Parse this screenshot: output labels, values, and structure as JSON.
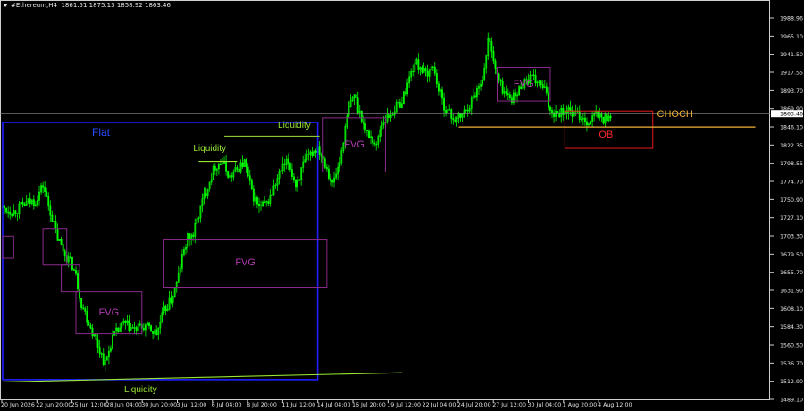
{
  "header": {
    "symbol": "#Ethereum,H4",
    "ohlc": "1861.51 1875.13 1858.92 1863.46"
  },
  "colors": {
    "background": "#000000",
    "candle": "#00ff00",
    "axis_text": "#e6e6e6",
    "flat_box": "#1f1fff",
    "fvg_box": "#8b2a8b",
    "liquidity": "#99e633",
    "choch": "#f2b233",
    "ob_box": "#e61a1a",
    "current_price_line": "#8c8c8c"
  },
  "chart_data": {
    "type": "candlestick",
    "title": "#Ethereum,H4",
    "y_ticks": [
      "1988.96",
      "1965.10",
      "1941.50",
      "1917.55",
      "1893.70",
      "1869.90",
      "1846.10",
      "1822.35",
      "1798.55",
      "1774.70",
      "1750.90",
      "1727.10",
      "1703.30",
      "1679.50",
      "1655.70",
      "1631.90",
      "1608.10",
      "1584.30",
      "1560.50",
      "1536.70",
      "1512.90",
      "1489.10"
    ],
    "ylim": [
      1489.1,
      1988.96
    ],
    "current_price": "1863.46",
    "x_ticks": [
      "20 Jun 2026",
      "22 Jun 20:00",
      "25 Jun 12:00",
      "28 Jun 04:00",
      "30 Jun 20:00",
      "3 Jul 12:00",
      "6 Jul 04:00",
      "8 Jul 20:00",
      "11 Jul 12:00",
      "14 Jul 04:00",
      "16 Jul 20:00",
      "19 Jul 12:00",
      "22 Jul 04:00",
      "24 Jul 20:00",
      "27 Jul 12:00",
      "30 Jul 04:00",
      "1 Aug 20:00",
      "4 Aug 12:00"
    ],
    "anchors": [
      [
        0,
        1740
      ],
      [
        6,
        1735
      ],
      [
        12,
        1745
      ],
      [
        18,
        1750
      ],
      [
        22,
        1770
      ],
      [
        26,
        1735
      ],
      [
        30,
        1700
      ],
      [
        34,
        1680
      ],
      [
        38,
        1665
      ],
      [
        40,
        1650
      ],
      [
        43,
        1615
      ],
      [
        47,
        1590
      ],
      [
        52,
        1560
      ],
      [
        56,
        1535
      ],
      [
        60,
        1570
      ],
      [
        66,
        1588
      ],
      [
        72,
        1580
      ],
      [
        78,
        1585
      ],
      [
        84,
        1575
      ],
      [
        88,
        1605
      ],
      [
        92,
        1620
      ],
      [
        95,
        1640
      ],
      [
        98,
        1675
      ],
      [
        101,
        1700
      ],
      [
        104,
        1705
      ],
      [
        108,
        1740
      ],
      [
        112,
        1770
      ],
      [
        116,
        1795
      ],
      [
        120,
        1800
      ],
      [
        124,
        1780
      ],
      [
        128,
        1790
      ],
      [
        132,
        1800
      ],
      [
        136,
        1760
      ],
      [
        140,
        1740
      ],
      [
        144,
        1745
      ],
      [
        148,
        1765
      ],
      [
        152,
        1790
      ],
      [
        156,
        1800
      ],
      [
        160,
        1770
      ],
      [
        164,
        1795
      ],
      [
        168,
        1810
      ],
      [
        172,
        1820
      ],
      [
        176,
        1800
      ],
      [
        180,
        1770
      ],
      [
        184,
        1800
      ],
      [
        186,
        1830
      ],
      [
        189,
        1870
      ],
      [
        192,
        1890
      ],
      [
        194,
        1870
      ],
      [
        196,
        1860
      ],
      [
        198,
        1840
      ],
      [
        200,
        1835
      ],
      [
        202,
        1830
      ],
      [
        204,
        1820
      ],
      [
        206,
        1845
      ],
      [
        208,
        1855
      ],
      [
        211,
        1860
      ],
      [
        214,
        1870
      ],
      [
        218,
        1880
      ],
      [
        222,
        1910
      ],
      [
        225,
        1930
      ],
      [
        228,
        1925
      ],
      [
        232,
        1910
      ],
      [
        234,
        1930
      ],
      [
        236,
        1915
      ],
      [
        238,
        1895
      ],
      [
        240,
        1880
      ],
      [
        242,
        1870
      ],
      [
        245,
        1860
      ],
      [
        248,
        1855
      ],
      [
        252,
        1865
      ],
      [
        256,
        1880
      ],
      [
        260,
        1900
      ],
      [
        263,
        1920
      ],
      [
        265,
        1960
      ],
      [
        267,
        1950
      ],
      [
        269,
        1920
      ],
      [
        272,
        1900
      ],
      [
        276,
        1885
      ],
      [
        280,
        1885
      ],
      [
        284,
        1905
      ],
      [
        288,
        1910
      ],
      [
        292,
        1905
      ],
      [
        296,
        1895
      ],
      [
        298,
        1875
      ],
      [
        300,
        1866
      ],
      [
        304,
        1866
      ],
      [
        308,
        1868
      ],
      [
        312,
        1863
      ],
      [
        316,
        1860
      ],
      [
        320,
        1852
      ],
      [
        324,
        1863
      ],
      [
        328,
        1856
      ],
      [
        332,
        1863
      ]
    ],
    "zones": [
      {
        "kind": "flat",
        "label": "Flat",
        "t1": 0,
        "t2": 172,
        "top": 1852,
        "bottom": 1515
      },
      {
        "kind": "fvg",
        "label": "",
        "t1": 0,
        "t2": 6,
        "top": 1703,
        "bottom": 1674
      },
      {
        "kind": "fvg",
        "label": "",
        "t1": 22,
        "t2": 35,
        "top": 1713,
        "bottom": 1665
      },
      {
        "kind": "fvg",
        "label": "",
        "t1": 32,
        "t2": 42,
        "top": 1665,
        "bottom": 1630
      },
      {
        "kind": "fvg",
        "label": "FVG",
        "t1": 40,
        "t2": 76,
        "top": 1630,
        "bottom": 1575
      },
      {
        "kind": "fvg",
        "label": "FVG",
        "t1": 88,
        "t2": 177,
        "top": 1698,
        "bottom": 1636
      },
      {
        "kind": "fvg",
        "label": "FVG",
        "t1": 175,
        "t2": 209,
        "top": 1858,
        "bottom": 1787
      },
      {
        "kind": "fvg",
        "label": "FVG",
        "t1": 270,
        "t2": 299,
        "top": 1924,
        "bottom": 1880
      },
      {
        "kind": "ob",
        "label": "OB",
        "t1": 307,
        "t2": 355,
        "top": 1867,
        "bottom": 1818
      }
    ],
    "lines": [
      {
        "kind": "liquidity",
        "label": "Liquidity",
        "t1": 107,
        "t2": 128,
        "y": 1801
      },
      {
        "kind": "liquidity",
        "label": "Liquidity",
        "t1": 121,
        "t2": 173,
        "y": 1834
      },
      {
        "kind": "liquidity",
        "label": "Liquidity",
        "t1": 0,
        "t2": 218,
        "y": 1512,
        "y2": 1524
      },
      {
        "kind": "choch",
        "label": "CHOCH",
        "t1": 249,
        "t2": 411,
        "y": 1846
      }
    ]
  }
}
